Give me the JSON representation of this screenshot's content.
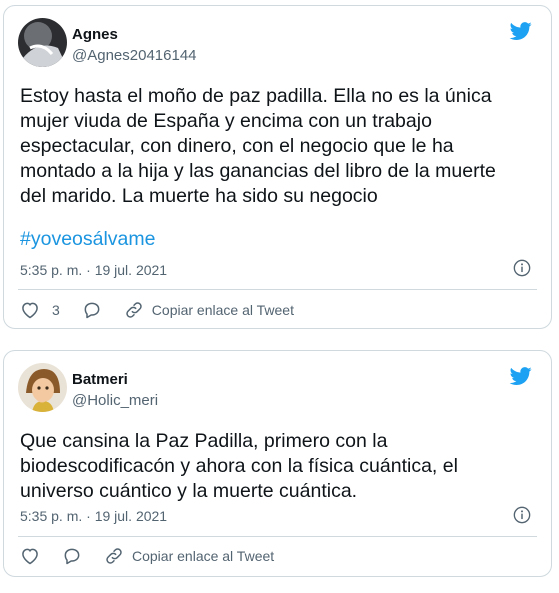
{
  "colors": {
    "accent": "#1da1f2",
    "hashtag": "#1b95e0",
    "muted": "#536471",
    "border": "#cfd9de"
  },
  "tweets": [
    {
      "author": {
        "name": "Agnes",
        "handle": "@Agnes20416144"
      },
      "text": "Estoy hasta el moño de paz padilla. Ella no es la única\nmujer viuda de España y encima con un trabajo\nespectacular, con dinero, con el negocio que le ha\nmontado a la hija y las ganancias del libro de la muerte\ndel marido. La muerte ha sido su negocio",
      "hashtag": "#yoveosálvame",
      "timestamp": "5:35 p. m. · 19 jul. 2021",
      "likes": "3",
      "copy_link_label": "Copiar enlace al Tweet",
      "icons": [
        "avatar",
        "twitter-bird-icon",
        "info-icon",
        "heart-icon",
        "reply-icon",
        "link-icon"
      ]
    },
    {
      "author": {
        "name": "Batmeri",
        "handle": "@Holic_meri"
      },
      "text": "Que cansina la Paz Padilla, primero con la\nbiodescodificacón y ahora con la física cuántica, el\nuniverso cuántico y la muerte cuántica.",
      "timestamp": "5:35 p. m. · 19 jul. 2021",
      "copy_link_label": "Copiar enlace al Tweet",
      "icons": [
        "avatar",
        "twitter-bird-icon",
        "info-icon",
        "heart-icon",
        "reply-icon",
        "link-icon"
      ]
    }
  ]
}
